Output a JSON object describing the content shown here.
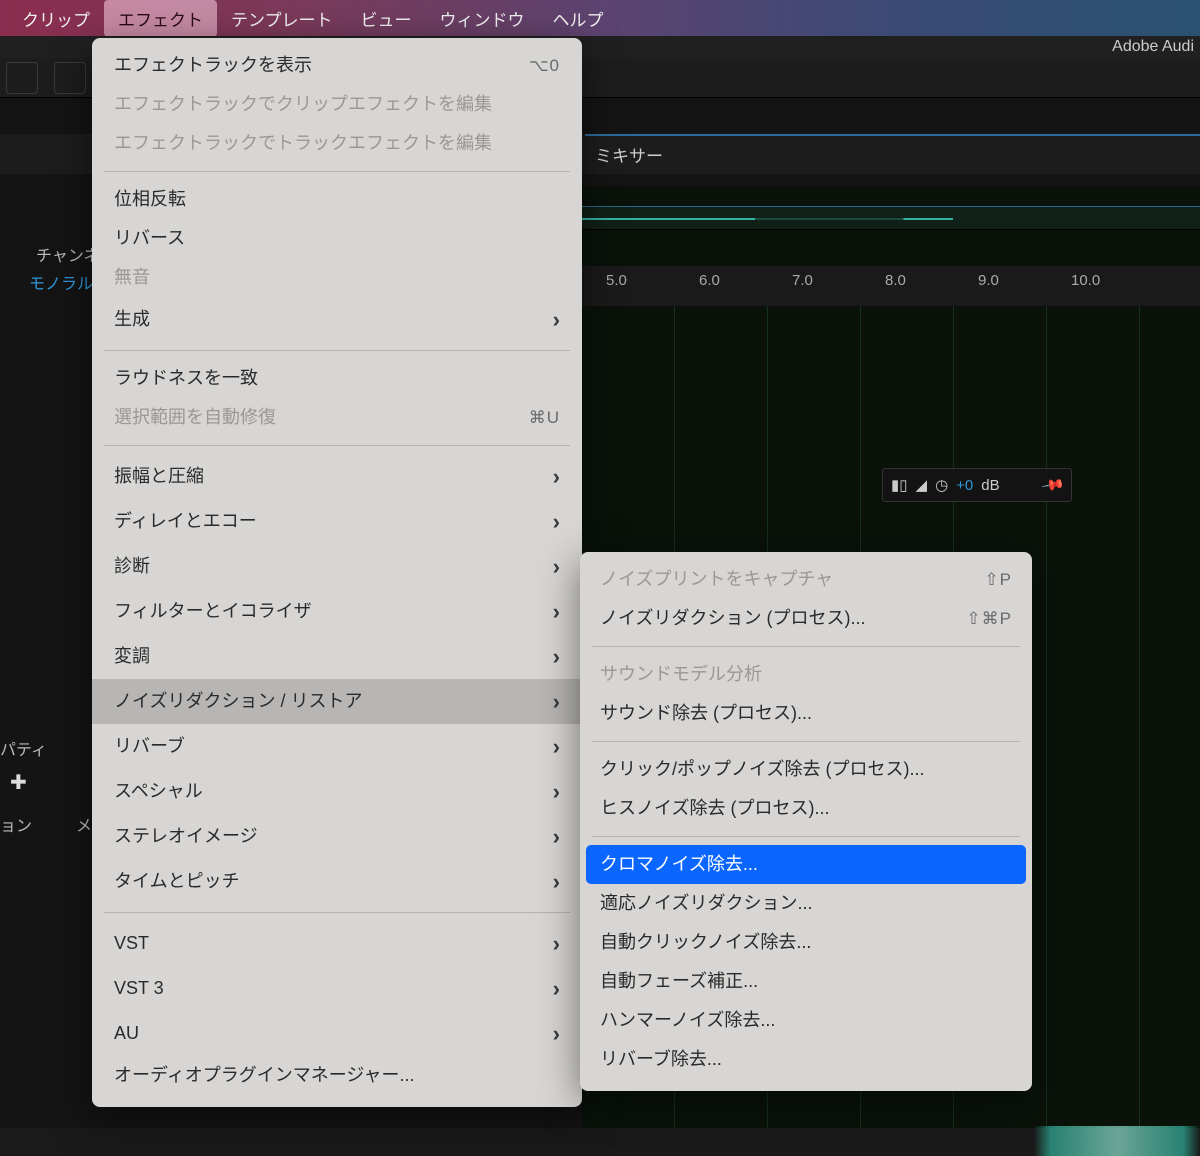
{
  "menubar": {
    "items": [
      "クリップ",
      "エフェクト",
      "テンプレート",
      "ビュー",
      "ウィンドウ",
      "ヘルプ"
    ],
    "activeIndex": 1
  },
  "app": {
    "title": "Adobe Audi"
  },
  "panels": {
    "mixer": "ミキサー",
    "channels": "チャンネ",
    "monoral": "モノラル",
    "property": "パティ",
    "ion": "ョン",
    "me": "メ"
  },
  "timeline": {
    "ticks": [
      "5.0",
      "6.0",
      "7.0",
      "8.0",
      "9.0",
      "10.0"
    ],
    "gain": {
      "value": "+0",
      "unit": "dB"
    }
  },
  "dropdown": {
    "groups": [
      [
        {
          "label": "エフェクトラックを表示",
          "shortcut": "⌥0",
          "sub": false,
          "disabled": false
        },
        {
          "label": "エフェクトラックでクリップエフェクトを編集",
          "shortcut": "",
          "sub": false,
          "disabled": true
        },
        {
          "label": "エフェクトラックでトラックエフェクトを編集",
          "shortcut": "",
          "sub": false,
          "disabled": true
        }
      ],
      [
        {
          "label": "位相反転",
          "shortcut": "",
          "sub": false,
          "disabled": false
        },
        {
          "label": "リバース",
          "shortcut": "",
          "sub": false,
          "disabled": false
        },
        {
          "label": "無音",
          "shortcut": "",
          "sub": false,
          "disabled": true
        },
        {
          "label": "生成",
          "shortcut": "",
          "sub": true,
          "disabled": false
        }
      ],
      [
        {
          "label": "ラウドネスを一致",
          "shortcut": "",
          "sub": false,
          "disabled": false
        },
        {
          "label": "選択範囲を自動修復",
          "shortcut": "⌘U",
          "sub": false,
          "disabled": true
        }
      ],
      [
        {
          "label": "振幅と圧縮",
          "shortcut": "",
          "sub": true,
          "disabled": false
        },
        {
          "label": "ディレイとエコー",
          "shortcut": "",
          "sub": true,
          "disabled": false
        },
        {
          "label": "診断",
          "shortcut": "",
          "sub": true,
          "disabled": false
        },
        {
          "label": "フィルターとイコライザ",
          "shortcut": "",
          "sub": true,
          "disabled": false
        },
        {
          "label": "変調",
          "shortcut": "",
          "sub": true,
          "disabled": false
        },
        {
          "label": "ノイズリダクション / リストア",
          "shortcut": "",
          "sub": true,
          "disabled": false,
          "hover": true
        },
        {
          "label": "リバーブ",
          "shortcut": "",
          "sub": true,
          "disabled": false
        },
        {
          "label": "スペシャル",
          "shortcut": "",
          "sub": true,
          "disabled": false
        },
        {
          "label": "ステレオイメージ",
          "shortcut": "",
          "sub": true,
          "disabled": false
        },
        {
          "label": "タイムとピッチ",
          "shortcut": "",
          "sub": true,
          "disabled": false
        }
      ],
      [
        {
          "label": "VST",
          "shortcut": "",
          "sub": true,
          "disabled": false
        },
        {
          "label": "VST 3",
          "shortcut": "",
          "sub": true,
          "disabled": false
        },
        {
          "label": "AU",
          "shortcut": "",
          "sub": true,
          "disabled": false
        },
        {
          "label": "オーディオプラグインマネージャー...",
          "shortcut": "",
          "sub": false,
          "disabled": false
        }
      ]
    ]
  },
  "submenu": {
    "groups": [
      [
        {
          "label": "ノイズプリントをキャプチャ",
          "shortcut": "⇧P",
          "disabled": true
        },
        {
          "label": "ノイズリダクション (プロセス)...",
          "shortcut": "⇧⌘P",
          "disabled": false
        }
      ],
      [
        {
          "label": "サウンドモデル分析",
          "shortcut": "",
          "disabled": true
        },
        {
          "label": "サウンド除去 (プロセス)...",
          "shortcut": "",
          "disabled": false
        }
      ],
      [
        {
          "label": "クリック/ポップノイズ除去 (プロセス)...",
          "shortcut": "",
          "disabled": false
        },
        {
          "label": "ヒスノイズ除去 (プロセス)...",
          "shortcut": "",
          "disabled": false
        }
      ],
      [
        {
          "label": "クロマノイズ除去...",
          "shortcut": "",
          "disabled": false,
          "selected": true
        },
        {
          "label": "適応ノイズリダクション...",
          "shortcut": "",
          "disabled": false
        },
        {
          "label": "自動クリックノイズ除去...",
          "shortcut": "",
          "disabled": false
        },
        {
          "label": "自動フェーズ補正...",
          "shortcut": "",
          "disabled": false
        },
        {
          "label": "ハンマーノイズ除去...",
          "shortcut": "",
          "disabled": false
        },
        {
          "label": "リバーブ除去...",
          "shortcut": "",
          "disabled": false
        }
      ]
    ]
  }
}
